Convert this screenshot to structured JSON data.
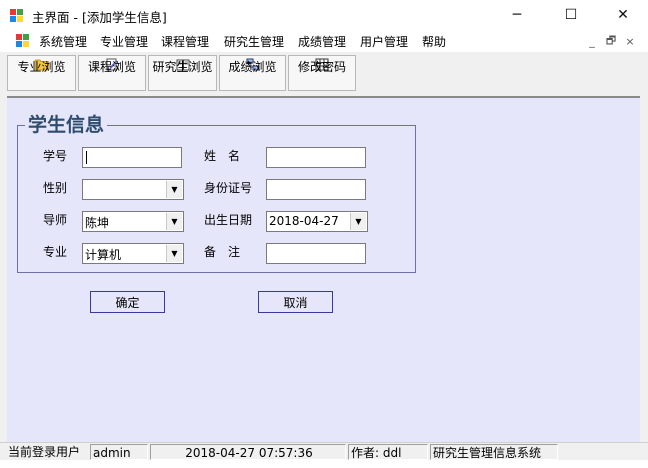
{
  "window": {
    "title": "主界面 - [添加学生信息]",
    "controls": {
      "minimize": "─",
      "maximize": "☐",
      "close": "✕"
    }
  },
  "menu": {
    "items": [
      "系统管理",
      "专业管理",
      "课程管理",
      "研究生管理",
      "成绩管理",
      "用户管理",
      "帮助"
    ],
    "mdi_controls": {
      "minimize": "_",
      "restore": "🗗",
      "close": "×"
    }
  },
  "toolbar": {
    "buttons": [
      {
        "label": "专业浏览",
        "icon": "folder-icon"
      },
      {
        "label": "课程浏览",
        "icon": "edit-doc-icon"
      },
      {
        "label": "研究生浏览",
        "icon": "book-icon"
      },
      {
        "label": "成绩浏览",
        "icon": "network-icon"
      },
      {
        "label": "修改密码",
        "icon": "table-icon"
      }
    ]
  },
  "form": {
    "group_title": "学生信息",
    "fields": {
      "student_id": {
        "label": "学号",
        "value": ""
      },
      "name": {
        "label": "姓　名",
        "value": ""
      },
      "gender": {
        "label": "性别",
        "value": ""
      },
      "id_card": {
        "label": "身份证号",
        "value": ""
      },
      "advisor": {
        "label": "导师",
        "value": "陈坤"
      },
      "birthdate": {
        "label": "出生日期",
        "value": "2018-04-27"
      },
      "major": {
        "label": "专业",
        "value": "计算机"
      },
      "remark": {
        "label": "备　注",
        "value": ""
      }
    },
    "confirm_label": "确定",
    "cancel_label": "取消"
  },
  "status": {
    "user_label": "当前登录用户",
    "user": "admin",
    "datetime": "2018-04-27  07:57:36",
    "author": "作者: ddl",
    "system": "研究生管理信息系统"
  },
  "colors": {
    "client_bg": "#e6e6fa",
    "group_title": "#2e4c6e",
    "group_border": "#7070a8",
    "button_border": "#3a3a9a"
  }
}
